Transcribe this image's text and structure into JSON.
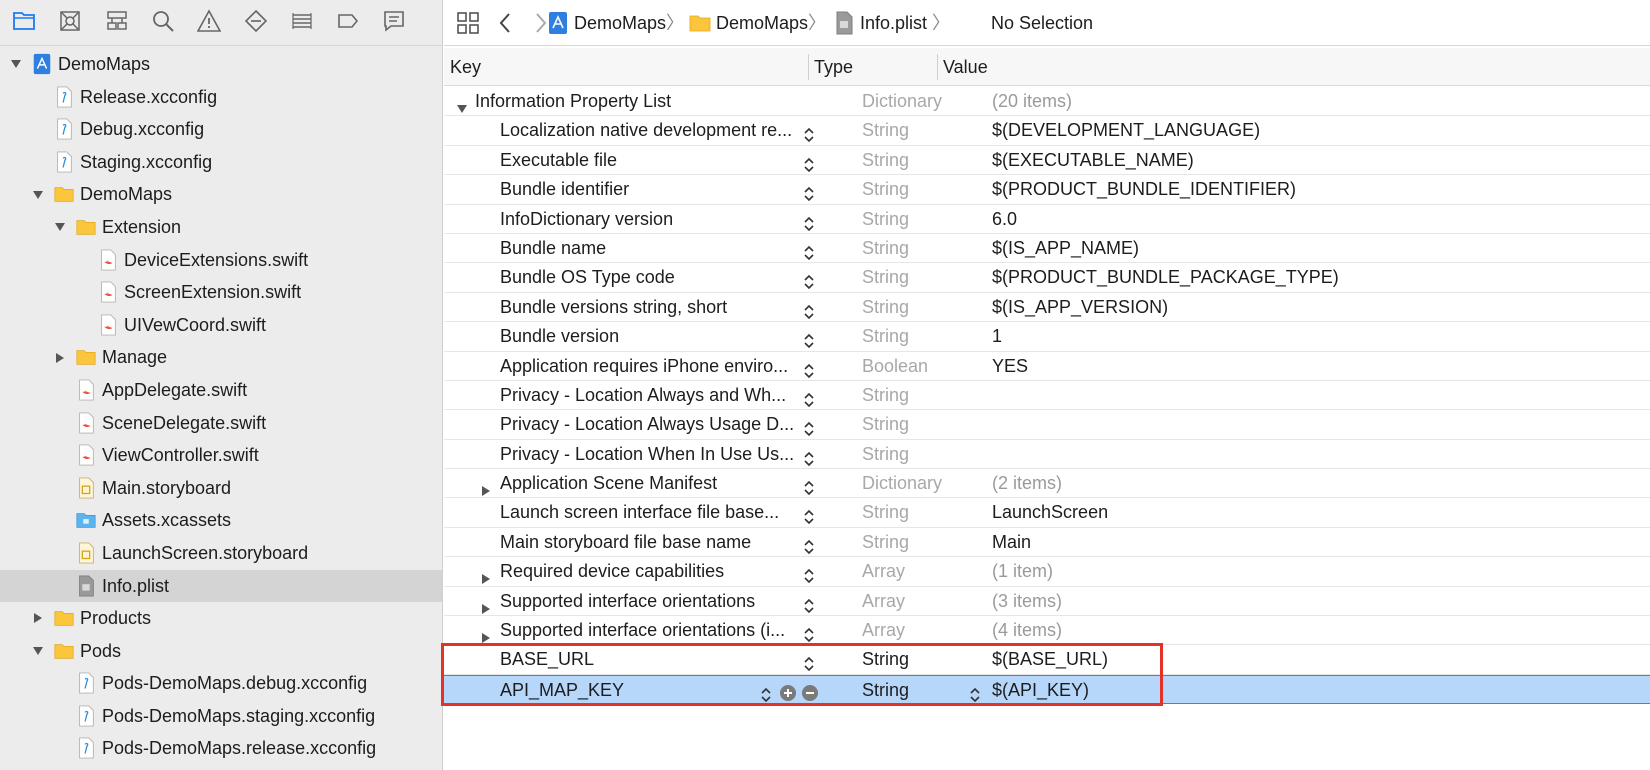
{
  "navigator": {
    "tabs": [
      {
        "icon": "folder-icon",
        "active": true
      },
      {
        "icon": "source-control-icon"
      },
      {
        "icon": "symbol-navigator-icon"
      },
      {
        "icon": "search-icon"
      },
      {
        "icon": "warning-icon"
      },
      {
        "icon": "test-diamond-icon"
      },
      {
        "icon": "debug-list-icon"
      },
      {
        "icon": "breakpoint-icon"
      },
      {
        "icon": "report-bubble-icon"
      }
    ],
    "tree": [
      {
        "label": "DemoMaps",
        "icon": "project-icon",
        "depth": 0,
        "disclosure": "open"
      },
      {
        "label": "Release.xcconfig",
        "icon": "xcconfig-file-icon",
        "depth": 1
      },
      {
        "label": "Debug.xcconfig",
        "icon": "xcconfig-file-icon",
        "depth": 1
      },
      {
        "label": "Staging.xcconfig",
        "icon": "xcconfig-file-icon",
        "depth": 1
      },
      {
        "label": "DemoMaps",
        "icon": "folder-icon",
        "depth": 1,
        "disclosure": "open"
      },
      {
        "label": "Extension",
        "icon": "folder-icon",
        "depth": 2,
        "disclosure": "open"
      },
      {
        "label": "DeviceExtensions.swift",
        "icon": "swift-file-icon",
        "depth": 3
      },
      {
        "label": "ScreenExtension.swift",
        "icon": "swift-file-icon",
        "depth": 3
      },
      {
        "label": "UIVewCoord.swift",
        "icon": "swift-file-icon",
        "depth": 3
      },
      {
        "label": "Manage",
        "icon": "folder-icon",
        "depth": 2,
        "disclosure": "closed"
      },
      {
        "label": "AppDelegate.swift",
        "icon": "swift-file-icon",
        "depth": 2
      },
      {
        "label": "SceneDelegate.swift",
        "icon": "swift-file-icon",
        "depth": 2
      },
      {
        "label": "ViewController.swift",
        "icon": "swift-file-icon",
        "depth": 2
      },
      {
        "label": "Main.storyboard",
        "icon": "storyboard-file-icon",
        "depth": 2
      },
      {
        "label": "Assets.xcassets",
        "icon": "asset-catalog-icon",
        "depth": 2
      },
      {
        "label": "LaunchScreen.storyboard",
        "icon": "storyboard-file-icon",
        "depth": 2
      },
      {
        "label": "Info.plist",
        "icon": "plist-file-icon",
        "depth": 2,
        "selected": true
      },
      {
        "label": "Products",
        "icon": "folder-icon",
        "depth": 1,
        "disclosure": "closed"
      },
      {
        "label": "Pods",
        "icon": "folder-icon",
        "depth": 1,
        "disclosure": "open"
      },
      {
        "label": "Pods-DemoMaps.debug.xcconfig",
        "icon": "xcconfig-file-icon",
        "depth": 2
      },
      {
        "label": "Pods-DemoMaps.staging.xcconfig",
        "icon": "xcconfig-file-icon",
        "depth": 2
      },
      {
        "label": "Pods-DemoMaps.release.xcconfig",
        "icon": "xcconfig-file-icon",
        "depth": 2
      }
    ]
  },
  "jumpbar": {
    "crumbs": [
      {
        "label": "DemoMaps",
        "icon": "project-icon"
      },
      {
        "label": "DemoMaps",
        "icon": "folder-icon"
      },
      {
        "label": "Info.plist",
        "icon": "plist-file-icon"
      },
      {
        "label": "No Selection"
      }
    ],
    "separator": "〉"
  },
  "plist": {
    "headers": {
      "key": "Key",
      "type": "Type",
      "value": "Value"
    },
    "rows": [
      {
        "key": "Information Property List",
        "type": "Dictionary",
        "value": "(20 items)",
        "disclosure": "open",
        "root": true,
        "muted": true
      },
      {
        "key": "Localization native development re...",
        "type": "String",
        "value": "$(DEVELOPMENT_LANGUAGE)"
      },
      {
        "key": "Executable file",
        "type": "String",
        "value": "$(EXECUTABLE_NAME)"
      },
      {
        "key": "Bundle identifier",
        "type": "String",
        "value": "$(PRODUCT_BUNDLE_IDENTIFIER)"
      },
      {
        "key": "InfoDictionary version",
        "type": "String",
        "value": "6.0"
      },
      {
        "key": "Bundle name",
        "type": "String",
        "value": "$(IS_APP_NAME)"
      },
      {
        "key": "Bundle OS Type code",
        "type": "String",
        "value": "$(PRODUCT_BUNDLE_PACKAGE_TYPE)"
      },
      {
        "key": "Bundle versions string, short",
        "type": "String",
        "value": "$(IS_APP_VERSION)"
      },
      {
        "key": "Bundle version",
        "type": "String",
        "value": "1"
      },
      {
        "key": "Application requires iPhone enviro...",
        "type": "Boolean",
        "value": "YES"
      },
      {
        "key": "Privacy - Location Always and Wh...",
        "type": "String",
        "value": ""
      },
      {
        "key": "Privacy - Location Always Usage D...",
        "type": "String",
        "value": ""
      },
      {
        "key": "Privacy - Location When In Use Us...",
        "type": "String",
        "value": ""
      },
      {
        "key": "Application Scene Manifest",
        "type": "Dictionary",
        "value": "(2 items)",
        "disclosure": "closed",
        "muted": true
      },
      {
        "key": "Launch screen interface file base...",
        "type": "String",
        "value": "LaunchScreen"
      },
      {
        "key": "Main storyboard file base name",
        "type": "String",
        "value": "Main"
      },
      {
        "key": "Required device capabilities",
        "type": "Array",
        "value": "(1 item)",
        "disclosure": "closed",
        "muted": true
      },
      {
        "key": "Supported interface orientations",
        "type": "Array",
        "value": "(3 items)",
        "disclosure": "closed",
        "muted": true
      },
      {
        "key": "Supported interface orientations (i...",
        "type": "Array",
        "value": "(4 items)",
        "disclosure": "closed",
        "muted": true
      },
      {
        "key": "BASE_URL",
        "type": "String",
        "value": "$(BASE_URL)",
        "typeDark": true
      },
      {
        "key": "API_MAP_KEY",
        "type": "String",
        "value": "$(API_KEY)",
        "typeDark": true,
        "selected": true
      }
    ]
  },
  "colors": {
    "accent": "#1a7cf5",
    "selection_row": "#b6d6fa",
    "annotation": "#e53228",
    "swift": "#f05138",
    "folder": "#fcc63c"
  }
}
